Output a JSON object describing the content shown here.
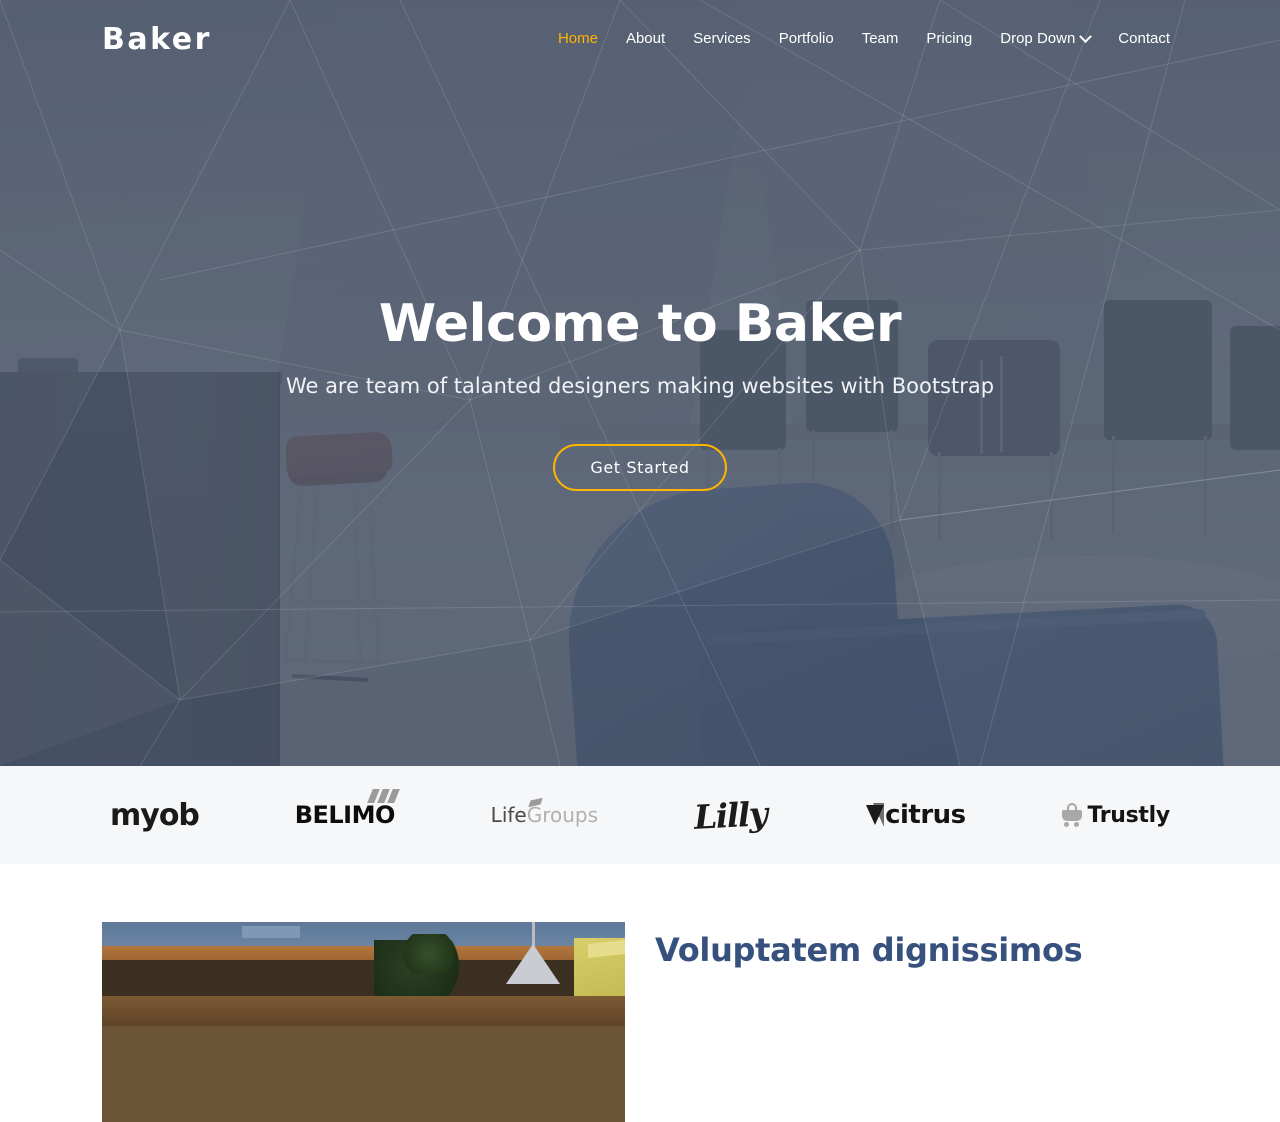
{
  "header": {
    "logo": "Baker",
    "nav": [
      {
        "label": "Home",
        "active": true,
        "dropdown": false
      },
      {
        "label": "About",
        "active": false,
        "dropdown": false
      },
      {
        "label": "Services",
        "active": false,
        "dropdown": false
      },
      {
        "label": "Portfolio",
        "active": false,
        "dropdown": false
      },
      {
        "label": "Team",
        "active": false,
        "dropdown": false
      },
      {
        "label": "Pricing",
        "active": false,
        "dropdown": false
      },
      {
        "label": "Drop Down",
        "active": false,
        "dropdown": true
      },
      {
        "label": "Contact",
        "active": false,
        "dropdown": false
      }
    ]
  },
  "hero": {
    "title": "Welcome to Baker",
    "subtitle": "We are team of talanted designers making websites with Bootstrap",
    "cta_label": "Get Started",
    "background_image": "office-interior-photo"
  },
  "clients": {
    "logos": [
      {
        "name": "myob",
        "text": "myob"
      },
      {
        "name": "belimo",
        "text": "BELIMO"
      },
      {
        "name": "lifegroups",
        "text": "LifeGroups",
        "part1": "Life",
        "part2": "Groups"
      },
      {
        "name": "lilly",
        "text": "Lilly"
      },
      {
        "name": "citrus",
        "text": "citrus"
      },
      {
        "name": "trustly",
        "text": "Trustly"
      }
    ]
  },
  "about": {
    "title": "Voluptatem dignissimos",
    "image": "restaurant-interior-photo"
  },
  "colors": {
    "accent": "#ffb400",
    "hero_overlay": "#495468",
    "heading_navy": "#37517e",
    "clients_bg": "#f6f7f9",
    "page_bg": "#ffffff",
    "nav_text": "#ffffff"
  }
}
